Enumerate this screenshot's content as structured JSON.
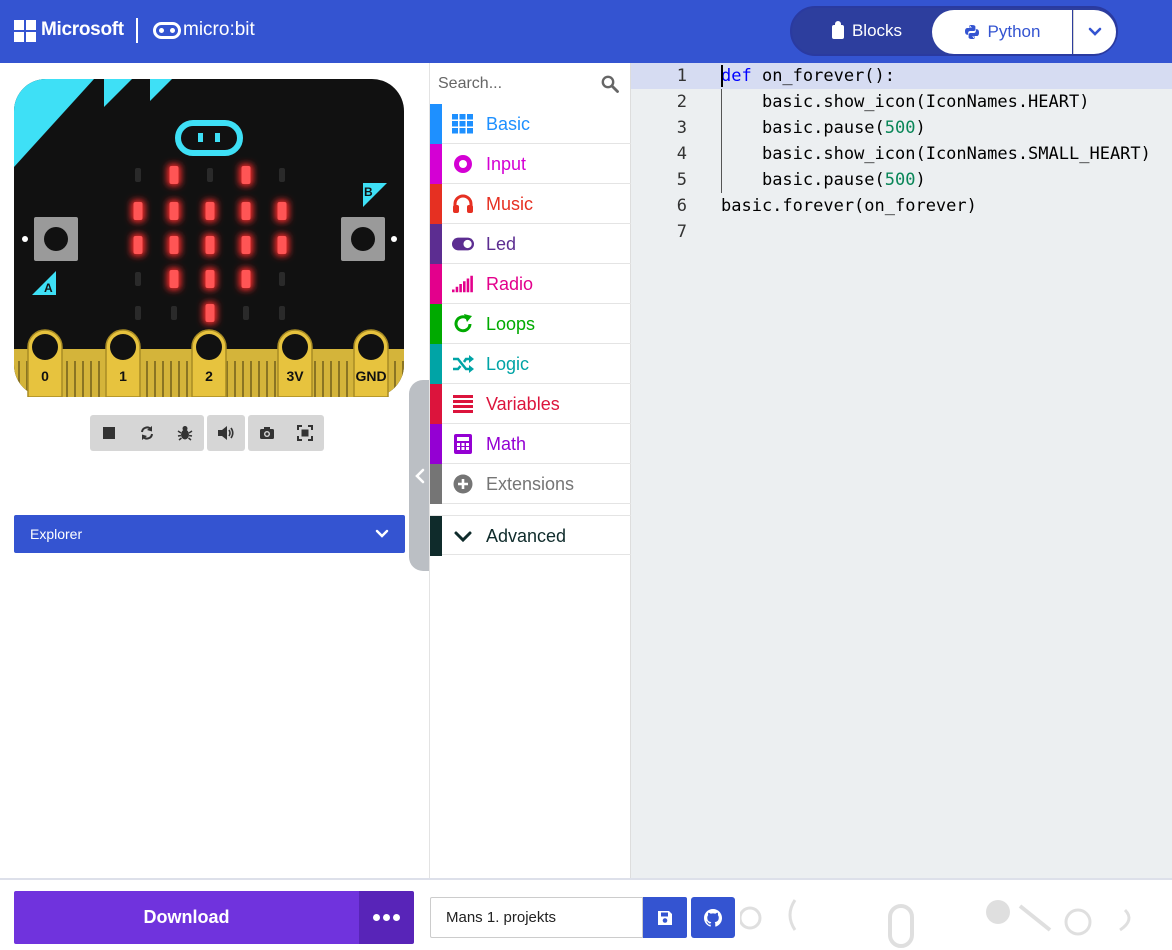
{
  "header": {
    "brand": "Microsoft",
    "product": "micro:bit",
    "modes": {
      "blocks_label": "Blocks",
      "python_label": "Python",
      "active": "Python"
    }
  },
  "simulator": {
    "buttons": {
      "a": "A",
      "b": "B"
    },
    "pins": [
      "0",
      "1",
      "2",
      "3V",
      "GND"
    ],
    "led_matrix": [
      [
        0,
        1,
        0,
        1,
        0
      ],
      [
        1,
        1,
        1,
        1,
        1
      ],
      [
        1,
        1,
        1,
        1,
        1
      ],
      [
        0,
        1,
        1,
        1,
        0
      ],
      [
        0,
        0,
        1,
        0,
        0
      ]
    ],
    "toolbar_icons": [
      "stop-icon",
      "restart-icon",
      "debug-icon",
      "sound-icon",
      "screenshot-icon",
      "fullscreen-icon"
    ]
  },
  "explorer": {
    "label": "Explorer"
  },
  "toolbox": {
    "search_placeholder": "Search...",
    "categories": [
      {
        "label": "Basic",
        "color": "#1e90ff",
        "icon": "grid-icon"
      },
      {
        "label": "Input",
        "color": "#d400d4",
        "icon": "input-icon"
      },
      {
        "label": "Music",
        "color": "#e63022",
        "icon": "headphones-icon"
      },
      {
        "label": "Led",
        "color": "#5c2d91",
        "icon": "toggle-icon"
      },
      {
        "label": "Radio",
        "color": "#e3008c",
        "icon": "signal-icon"
      },
      {
        "label": "Loops",
        "color": "#00aa00",
        "icon": "loop-icon"
      },
      {
        "label": "Logic",
        "color": "#00a4a6",
        "icon": "shuffle-icon"
      },
      {
        "label": "Variables",
        "color": "#dc143c",
        "icon": "lines-icon"
      },
      {
        "label": "Math",
        "color": "#9400d3",
        "icon": "calculator-icon"
      },
      {
        "label": "Extensions",
        "color": "#757575",
        "icon": "plus-circle-icon"
      }
    ],
    "advanced_label": "Advanced"
  },
  "editor": {
    "lines": [
      {
        "num": "1",
        "indent": "",
        "parts": [
          [
            "kw",
            "def"
          ],
          [
            "",
            " on_forever():"
          ]
        ]
      },
      {
        "num": "2",
        "indent": "    ",
        "parts": [
          [
            "",
            "basic.show_icon(IconNames.HEART)"
          ]
        ]
      },
      {
        "num": "3",
        "indent": "    ",
        "parts": [
          [
            "",
            "basic.pause("
          ],
          [
            "num",
            "500"
          ],
          [
            "",
            ")"
          ]
        ]
      },
      {
        "num": "4",
        "indent": "    ",
        "parts": [
          [
            "",
            "basic.show_icon(IconNames.SMALL_HEART)"
          ]
        ]
      },
      {
        "num": "5",
        "indent": "    ",
        "parts": [
          [
            "",
            "basic.pause("
          ],
          [
            "num",
            "500"
          ],
          [
            "",
            ")"
          ]
        ]
      },
      {
        "num": "6",
        "indent": "",
        "parts": [
          [
            "",
            "basic.forever(on_forever)"
          ]
        ]
      },
      {
        "num": "7",
        "indent": "",
        "parts": []
      }
    ]
  },
  "footer": {
    "download_label": "Download",
    "project_name": "Mans 1. projekts"
  }
}
